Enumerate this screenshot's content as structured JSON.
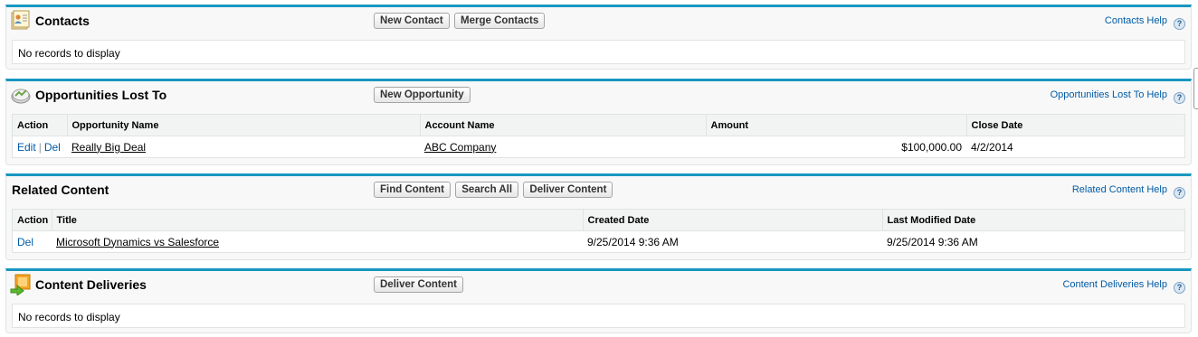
{
  "contacts": {
    "title": "Contacts",
    "buttons": [
      "New Contact",
      "Merge Contacts"
    ],
    "help": "Contacts Help",
    "empty": "No records to display"
  },
  "opportunities": {
    "title": "Opportunities Lost To",
    "buttons": [
      "New Opportunity"
    ],
    "help": "Opportunities Lost To Help",
    "columns": [
      "Action",
      "Opportunity Name",
      "Account Name",
      "Amount",
      "Close Date"
    ],
    "rows": [
      {
        "edit": "Edit",
        "del": "Del",
        "name": "Really Big Deal",
        "account": "ABC Company",
        "amount": "$100,000.00",
        "close_date": "4/2/2014"
      }
    ]
  },
  "related_content": {
    "title": "Related Content",
    "buttons": [
      "Find Content",
      "Search All",
      "Deliver Content"
    ],
    "help": "Related Content Help",
    "columns": [
      "Action",
      "Title",
      "Created Date",
      "Last Modified Date"
    ],
    "rows": [
      {
        "del": "Del",
        "title": "Microsoft Dynamics vs Salesforce",
        "created": "9/25/2014 9:36 AM",
        "modified": "9/25/2014 9:36 AM"
      }
    ]
  },
  "content_deliveries": {
    "title": "Content Deliveries",
    "buttons": [
      "Deliver Content"
    ],
    "help": "Content Deliveries Help",
    "empty": "No records to display"
  },
  "help_icon_glyph": "?",
  "action_separator": "|",
  "colors": {
    "accent": "#1797c0",
    "link": "#015ba7",
    "panel_bg": "#f8f8f8"
  }
}
